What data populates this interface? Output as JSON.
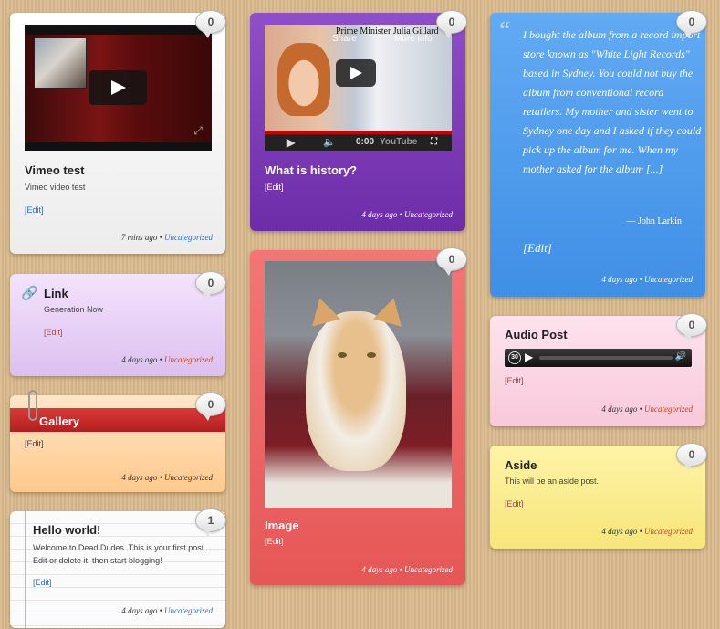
{
  "comment_icon": "speech-bubble-icon",
  "colors": {
    "white_card": "#f4f4f4",
    "purple_card": "#7a35b5",
    "blue_card": "#4b98ea",
    "lavender_card": "#e3c9f3",
    "red_card": "#ee6b6b",
    "pink_card": "#fbd5e3",
    "orange_card": "#ffd09a",
    "yellow_card": "#fbee8e",
    "link_blue": "#2a6ccf"
  },
  "posts": {
    "vimeo": {
      "title": "Vimeo test",
      "excerpt": "Vimeo video test",
      "edit": "[Edit]",
      "time": "7 mins ago",
      "sep": "•",
      "category": "Uncategorized",
      "comments": "0"
    },
    "history": {
      "title": "What is history?",
      "edit": "[Edit]",
      "time": "4 days ago",
      "sep": "•",
      "category": "Uncategorized",
      "comments": "0",
      "video": {
        "overlay_title": "Prime Minister Julia Gillard",
        "share": "Share",
        "more_info": "More info",
        "time": "0:00",
        "logo": "YouTube"
      }
    },
    "quote": {
      "text": "I bought the album from a record import store known as \"White Light Records\" based in Sydney. You could not buy the album from conventional record retailers. My mother and sister went to Sydney one day and I asked if they could pick up the album for me. When my mother asked for the album [...]",
      "author": "— John Larkin",
      "edit": "[Edit]",
      "time": "4 days ago",
      "sep": "•",
      "category": "Uncategorized",
      "comments": "0"
    },
    "link": {
      "title": "Link",
      "excerpt": "Generation Now",
      "edit": "[Edit]",
      "time": "4 days ago",
      "sep": "•",
      "category": "Uncategorized",
      "comments": "0"
    },
    "image": {
      "title": "Image",
      "edit": "[Edit]",
      "time": "4 days ago",
      "sep": "•",
      "category": "Uncategorized",
      "comments": "0"
    },
    "audio": {
      "title": "Audio Post",
      "edit": "[Edit]",
      "time": "4 days ago",
      "sep": "•",
      "category": "Uncategorized",
      "comments": "0",
      "player_skip": "30"
    },
    "gallery": {
      "title": "Gallery",
      "edit": "[Edit]",
      "time": "4 days ago",
      "sep": "•",
      "category": "Uncategorized",
      "comments": "0"
    },
    "aside": {
      "title": "Aside",
      "excerpt": "This will be an aside post.",
      "edit": "[Edit]",
      "time": "4 days ago",
      "sep": "•",
      "category": "Uncategorized",
      "comments": "0"
    },
    "hello": {
      "title": "Hello world!",
      "excerpt": "Welcome to Dead Dudes. This is your first post. Edit or delete it, then start blogging!",
      "edit": "[Edit]",
      "time": "4 days ago",
      "sep": "•",
      "category": "Uncategorized",
      "comments": "1"
    }
  }
}
